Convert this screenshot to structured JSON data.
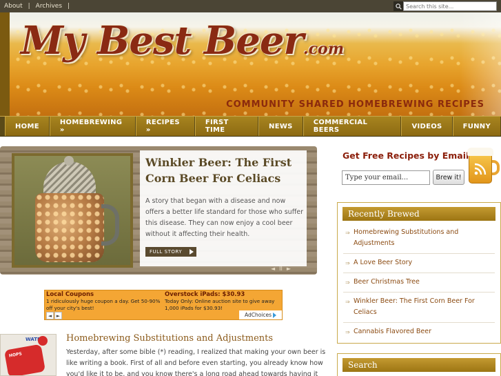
{
  "topbar": {
    "links": [
      "About",
      "Archives"
    ],
    "separator": "|",
    "search_placeholder": "Search this site..."
  },
  "header": {
    "logo_main": "My Best Beer",
    "logo_suffix": ".com",
    "tagline": "COMMUNITY SHARED HOMEBREWING RECIPES"
  },
  "nav": {
    "items": [
      "HOME",
      "HOMEBREWING »",
      "RECIPES »",
      "FIRST TIME",
      "NEWS",
      "COMMERCIAL BEERS",
      "VIDEOS",
      "FUNNY"
    ]
  },
  "featured": {
    "title": "Winkler Beer: The First Corn Beer For Celiacs",
    "excerpt": "A story that began with a disease and now offers a better life standard for those who suffer this disease. They can now enjoy a cool beer without it affecting their health.",
    "button": "FULL STORY",
    "controls": [
      "◄",
      "II",
      "►"
    ]
  },
  "ad": {
    "col1_title": "Local Coupons",
    "col1_text": "1 ridiculously huge coupon a day. Get 50-90% off your city's best!",
    "col2_title": "Overstock iPads: $30.93",
    "col2_text": "Today Only: Online auction site to give away 1,000 iPads for $30.93!",
    "nav_prev": "◄",
    "nav_next": "►",
    "adchoices": "AdChoices"
  },
  "post": {
    "thumb_label_top": "WATER",
    "thumb_label_piece": "HOPS",
    "title": "Homebrewing Substitutions and Adjustments",
    "excerpt": "Yesterday, after some bible (*) reading, I realized that making your own beer is like writing a book. First of all and before even starting, you already know how you'd like it to be, and you know there's a long road ahead towards having it"
  },
  "sidebar": {
    "email_title": "Get Free Recipes by Email",
    "email_value": "Type your email...",
    "brew_button": "Brew it!",
    "recent_title": "Recently Brewed",
    "recent_bullet": "⇒",
    "recent_items": [
      "Homebrewing Substitutions and Adjustments",
      "A Love Beer Story",
      "Beer Christmas Tree",
      "Winkler Beer: The First Corn Beer For Celiacs",
      "Cannabis Flavored Beer"
    ],
    "search_title": "Search"
  },
  "colors": {
    "nav_gold": "#a8841f",
    "title_red": "#8b1e0a",
    "link_brown": "#8b4b12",
    "box_border": "#c9a94a"
  }
}
